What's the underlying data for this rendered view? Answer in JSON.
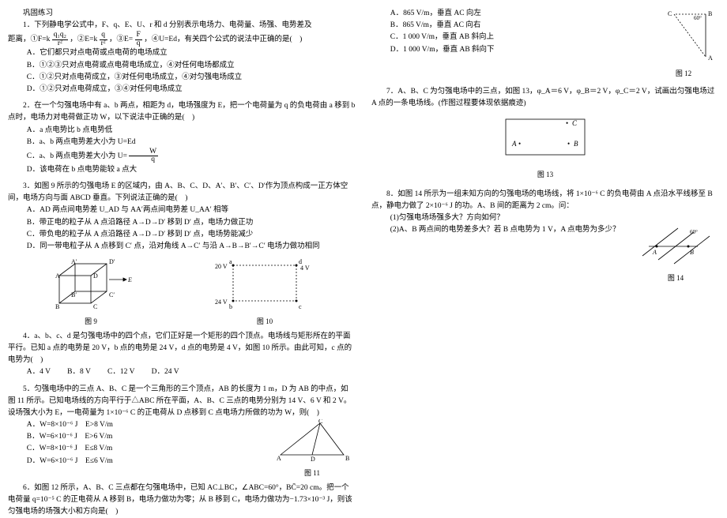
{
  "header": "巩固练习",
  "q1": {
    "stem1": "1．下列静电学公式中，F、q、E、U、r 和 d 分别表示电场力、电荷量、场强、电势差及",
    "stem2": "距离，①F=k",
    "frac1n": "q₁q₂",
    "frac1d": "r²",
    "stem2b": "，②E=k",
    "frac2n": "q",
    "frac2d": "r²",
    "stem2c": "，③E=",
    "frac3n": "F",
    "frac3d": "q",
    "stem2d": "，④U=Ed，有关四个公式的说法中正确的是(　)",
    "a": "A．它们都只对点电荷或点电荷的电场成立",
    "b": "B．①②③只对点电荷或点电荷电场成立，④对任何电场都成立",
    "c": "C．①②只对点电荷成立，③对任何电场成立，④对匀强电场成立",
    "d": "D．①②只对点电荷成立，③④对任何电场成立"
  },
  "q2": {
    "stem": "2．在一个匀强电场中有 a、b 两点，相距为 d，电场强度为 E，把一个电荷量为 q 的负电荷由 a 移到 b 点时，电场力对电荷做正功 W，以下说法中正确的是(　)",
    "a": "A．a 点电势比 b 点电势低",
    "b": "B．a、b 两点电势差大小为 U=Ed",
    "cpre": "C．a、b 两点电势差大小为 U=",
    "cn": "W",
    "cd": "q",
    "d": "D．该电荷在 b 点电势能较 a 点大"
  },
  "q3": {
    "stem": "3．如图 9 所示的匀强电场 E 的区域内，由 A、B、C、D、A′、B′、C′、D′作为顶点构成一正方体空间，电场方向与面 ABCD 垂直。下列说法正确的是(　)",
    "a": "A．AD 两点间电势差 U_AD 与 AA′两点间电势差 U_AA′ 相等",
    "b": "B．带正电的粒子从 A 点沿路径 A→D→D′ 移到 D′ 点，电场力做正功",
    "c": "C．带负电的粒子从 A 点沿路径 A→D→D′ 移到 D′ 点，电场势能减少",
    "d": "D．同一带电粒子从 A 点移到 C′ 点，沿对角线 A→C′ 与沿 A→B→B′→C′ 电场力做功相同"
  },
  "fig9": "图 9",
  "fig10": "图 10",
  "q4": {
    "stem": "4．a、b、c、d 是匀强电场中的四个点，它们正好是一个矩形的四个顶点。电场线与矩形所在的平面平行。已知 a 点的电势是 20 V，b 点的电势是 24 V，d 点的电势是 4 V，如图 10 所示。由此可知，c 点的电势为(　)",
    "a": "A．4 V",
    "b": "B．8 V",
    "c": "C．12 V",
    "d": "D．24 V"
  },
  "q5": {
    "stem": "5．匀强电场中的三点 A、B、C 是一个三角形的三个顶点，AB 的长度为 1 m，D 为 AB 的中点，如图 11 所示。已知电场线的方向平行于△ABC 所在平面，A、B、C 三点的电势分别为 14 V、6 V 和 2 V。设场强大小为 E，一电荷量为 1×10⁻⁶ C 的正电荷从 D 点移到 C 点电场力所做的功为 W，则(　)",
    "a": "A．W=8×10⁻⁶ J　E>8 V/m",
    "b": "B．W=6×10⁻⁶ J　E>6 V/m",
    "c": "C．W=8×10⁻⁶ J　E≤8 V/m",
    "d": "D．W=6×10⁻⁶ J　E≤6 V/m"
  },
  "fig11": "图 11",
  "q6": {
    "stem": "6．如图 12 所示，A、B、C 三点都在匀强电场中，已知 AC⊥BC，∠ABC=60°，BC̄=20 cm。把一个电荷量 q=10⁻⁵ C 的正电荷从 A 移到 B，电场力做功为零；从 B 移到 C，电场力做功为−1.73×10⁻³ J，则该匀强电场的场强大小和方向是(　)",
    "a": "A．865 V/m，垂直 AC 向左",
    "b": "B．865 V/m，垂直 AC 向右",
    "c": "C．1 000 V/m，垂直 AB 斜向上",
    "d": "D．1 000 V/m，垂直 AB 斜向下"
  },
  "fig12": "图 12",
  "q7": {
    "stem": "7．A、B、C 为匀强电场中的三点，如图 13，φ_A＝6 V，φ_B＝2 V，φ_C＝2 V，试画出匀强电场过 A 点的一条电场线。(作图过程要体现依据痕迹)"
  },
  "fig13": "图 13",
  "q8": {
    "stem": "8．如图 14 所示为一组未知方向的匀强电场的电场线，将 1×10⁻⁶ C 的负电荷由 A 点沿水平线移至 B 点，静电力做了 2×10⁻⁶ J 的功。A、B 间的距离为 2 cm。问：",
    "p1": "(1)匀强电场场强多大？方向如何？",
    "p2": "(2)A、B 两点间的电势差多大？若 B 点电势为 1 V，A 点电势为多少？"
  },
  "fig14": "图 14",
  "fig10labels": {
    "a": "a",
    "b": "b",
    "c": "c",
    "d": "d",
    "va": "20 V",
    "vb": "24 V",
    "vd": "4 V"
  },
  "fig9labels": {
    "A": "A",
    "B": "B",
    "C": "C",
    "D": "D",
    "Ap": "A′",
    "Bp": "B′",
    "Cp": "C′",
    "Dp": "D′",
    "E": "E"
  },
  "fig11labels": {
    "A": "A",
    "B": "B",
    "C": "C",
    "D": "D"
  },
  "fig12labels": {
    "A": "A",
    "B": "B",
    "C": "C",
    "ang": "60°"
  },
  "fig13labels": {
    "A": "A",
    "bull": "•",
    "B": "B",
    "C": "C",
    "Cbull": "•"
  },
  "fig14labels": {
    "A": "A",
    "B": "B",
    "ang": "60°"
  }
}
